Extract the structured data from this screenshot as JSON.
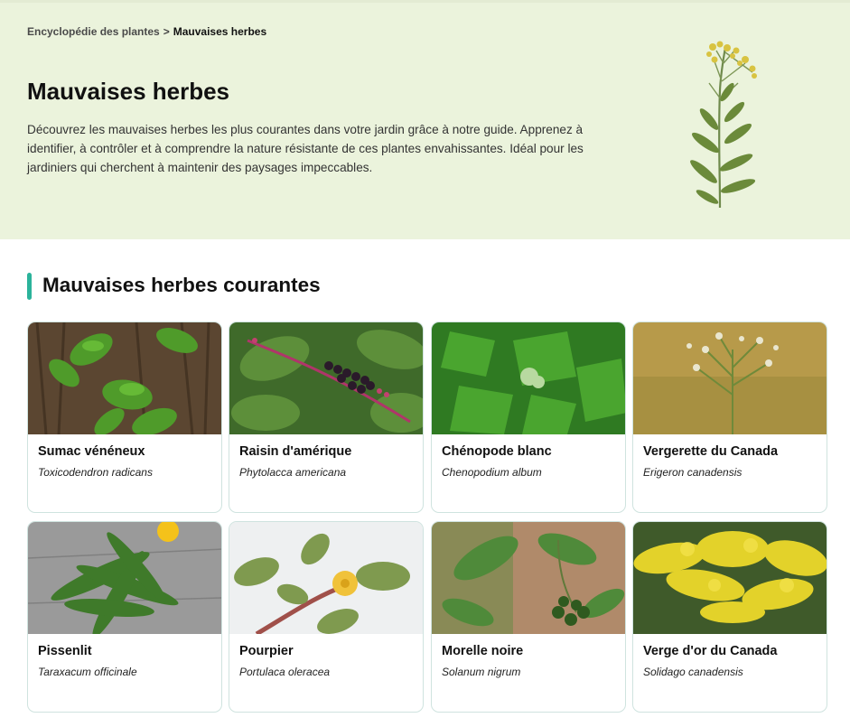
{
  "breadcrumb": {
    "home": "Encyclopédie des plantes",
    "separator": ">",
    "current": "Mauvaises herbes"
  },
  "hero": {
    "title": "Mauvaises herbes",
    "intro": "Découvrez les mauvaises herbes les plus courantes dans votre jardin grâce à notre guide. Apprenez à identifier, à contrôler et à comprendre la nature résistante de ces plantes envahissantes. Idéal pour les jardiniers qui cherchent à maintenir des paysages impeccables.",
    "image_icon": "weed-plant-illustration"
  },
  "section": {
    "title": "Mauvaises herbes courantes",
    "accent_color": "#2bb39b"
  },
  "cards": [
    {
      "name": "Sumac vénéneux",
      "latin": "Toxicodendron radicans",
      "image_icon": "poison-ivy-photo"
    },
    {
      "name": "Raisin d'amérique",
      "latin": "Phytolacca americana",
      "image_icon": "pokeweed-photo"
    },
    {
      "name": "Chénopode blanc",
      "latin": "Chenopodium album",
      "image_icon": "lambsquarters-photo"
    },
    {
      "name": "Vergerette du Canada",
      "latin": "Erigeron canadensis",
      "image_icon": "horseweed-photo"
    },
    {
      "name": "Pissenlit",
      "latin": "Taraxacum officinale",
      "image_icon": "dandelion-photo"
    },
    {
      "name": "Pourpier",
      "latin": "Portulaca oleracea",
      "image_icon": "purslane-photo"
    },
    {
      "name": "Morelle noire",
      "latin": "Solanum nigrum",
      "image_icon": "nightshade-photo"
    },
    {
      "name": "Verge d'or du Canada",
      "latin": "Solidago canadensis",
      "image_icon": "goldenrod-photo"
    }
  ],
  "colors": {
    "hero_background": "#ebf3dc",
    "card_border": "#cfe3df"
  }
}
